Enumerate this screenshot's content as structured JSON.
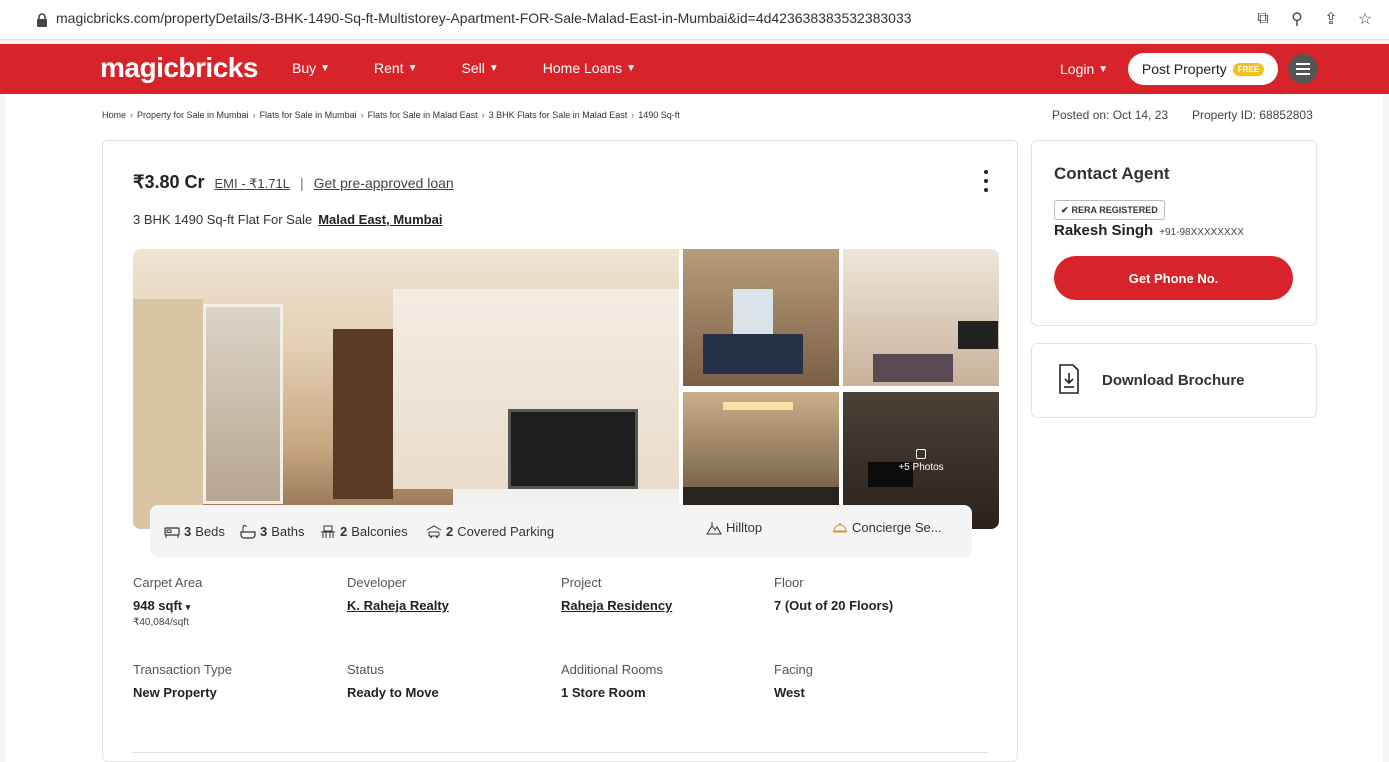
{
  "browser": {
    "url": "magicbricks.com/propertyDetails/3-BHK-1490-Sq-ft-Multistorey-Apartment-FOR-Sale-Malad-East-in-Mumbai&id=4d423638383532383033",
    "tool_icons": [
      "install-app-icon",
      "zoom-icon",
      "share-icon",
      "bookmark-star-icon"
    ]
  },
  "header": {
    "logo": "magicbricks",
    "nav": [
      {
        "label": "Buy"
      },
      {
        "label": "Rent"
      },
      {
        "label": "Sell"
      },
      {
        "label": "Home Loans"
      }
    ],
    "login": "Login",
    "post_property": "Post Property",
    "free_badge": "FREE",
    "brand_color": "#d8232a"
  },
  "breadcrumbs": [
    "Home",
    "Property for Sale in Mumbai",
    "Flats for Sale in Mumbai",
    "Flats for Sale in Malad East",
    "3 BHK Flats for Sale in Malad East",
    "1490 Sq-ft"
  ],
  "meta": {
    "posted": "Posted on: Oct 14, 23",
    "property_id": "Property ID: 68852803"
  },
  "listing": {
    "price": "₹3.80 Cr",
    "emi": "EMI - ₹1.71L",
    "separator": "|",
    "loan_link": "Get pre-approved loan",
    "subtitle": "3 BHK 1490 Sq-ft Flat For Sale",
    "location": "Malad East, Mumbai",
    "photos_count": "+5 Photos"
  },
  "features": {
    "beds_count": "3",
    "beds_label": "Beds",
    "baths_count": "3",
    "baths_label": "Baths",
    "balconies_count": "2",
    "balconies_label": "Balconies",
    "parking_count": "2",
    "parking_label": "Covered Parking",
    "amenity1": "Hilltop",
    "amenity2": "Concierge Se..."
  },
  "details": {
    "carpet_area_label": "Carpet Area",
    "carpet_area_value": "948 sqft",
    "carpet_area_rate": "₹40,084/sqft",
    "developer_label": "Developer",
    "developer_value": "K. Raheja Realty",
    "project_label": "Project",
    "project_value": "Raheja Residency",
    "floor_label": "Floor",
    "floor_value": "7 (Out of 20 Floors)",
    "transaction_label": "Transaction Type",
    "transaction_value": "New Property",
    "status_label": "Status",
    "status_value": "Ready to Move",
    "rooms_label": "Additional Rooms",
    "rooms_value": "1 Store Room",
    "facing_label": "Facing",
    "facing_value": "West"
  },
  "contact": {
    "title": "Contact Agent",
    "rera": "RERA REGISTERED",
    "agent_name": "Rakesh Singh",
    "agent_phone": "+91-98XXXXXXXX",
    "phone_button": "Get Phone No."
  },
  "brochure": {
    "label": "Download Brochure"
  }
}
